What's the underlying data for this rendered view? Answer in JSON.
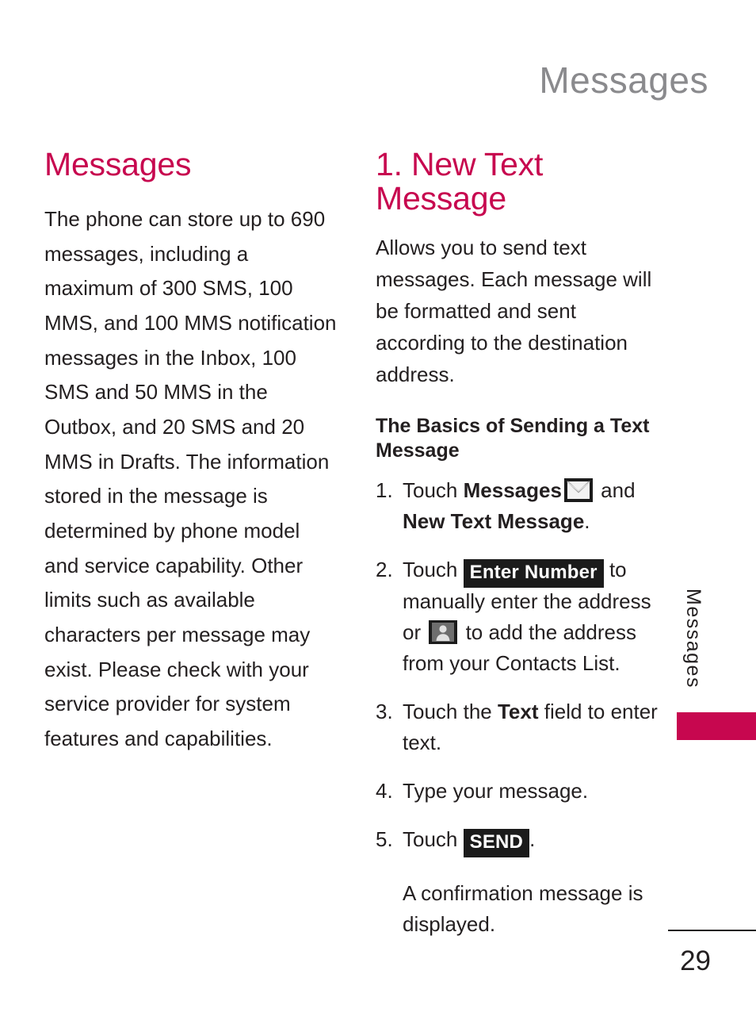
{
  "header": {
    "running_title": "Messages"
  },
  "left_column": {
    "title": "Messages",
    "paragraph": "The phone can store up to 690 messages, including a maximum of 300 SMS, 100 MMS, and 100 MMS notification messages in the Inbox, 100 SMS and 50 MMS in the Outbox, and 20 SMS and 20 MMS in Drafts. The information stored in the message is determined by phone model and service capability. Other limits such as available characters per message may exist. Please check with your service provider for system features and capabilities."
  },
  "right_column": {
    "title": "1. New Text Message",
    "intro": "Allows you to send text messages. Each message will be formatted and sent according to the destination address.",
    "subheading": "The Basics of Sending a Text Message",
    "steps": [
      {
        "number": "1.",
        "text_before": "Touch ",
        "bold_1": "Messages",
        "icon": "envelope-icon",
        "text_middle": " and ",
        "bold_2": "New Text Message",
        "text_after": "."
      },
      {
        "number": "2.",
        "text_before": "Touch ",
        "chip": "Enter Number",
        "text_middle": " to manually enter the address or ",
        "icon": "contact-person-icon",
        "text_after": " to add the address from your Contacts List."
      },
      {
        "number": "3.",
        "text_before": "Touch the ",
        "bold_1": "Text",
        "text_after": " field to enter text."
      },
      {
        "number": "4.",
        "text_before": "Type your message."
      },
      {
        "number": "5.",
        "text_before": "Touch ",
        "chip": "SEND",
        "text_after": "."
      }
    ],
    "step_note": "A confirmation message is displayed."
  },
  "thumb_tab": {
    "label": "Messages",
    "color": "#c7074f"
  },
  "footer": {
    "page_number": "29"
  },
  "colors": {
    "accent": "#c7074f",
    "header_gray": "#8a8a8d",
    "body_black": "#231f20",
    "chip_black": "#1b1b1b"
  }
}
